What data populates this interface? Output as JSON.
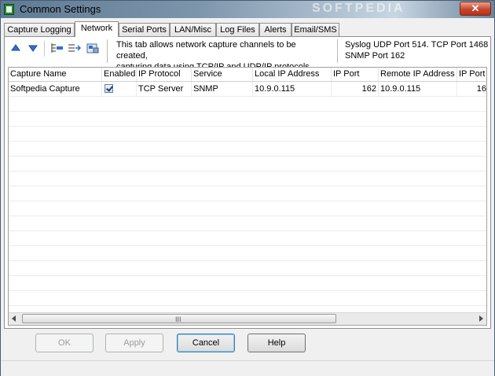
{
  "window": {
    "title": "Common Settings",
    "watermark": "SOFTPEDIA",
    "close_glyph": "✕"
  },
  "tabs": [
    {
      "label": "Capture Logging",
      "active": false
    },
    {
      "label": "Network",
      "active": true
    },
    {
      "label": "Serial Ports",
      "active": false
    },
    {
      "label": "LAN/Misc",
      "active": false
    },
    {
      "label": "Log Files",
      "active": false
    },
    {
      "label": "Alerts",
      "active": false
    },
    {
      "label": "Email/SMS",
      "active": false
    }
  ],
  "toolbar": {
    "icons": [
      "move-up-icon",
      "move-down-icon",
      "add-channel-icon",
      "insert-channel-icon",
      "channel-properties-icon"
    ]
  },
  "info": {
    "line1": "This tab allows network capture channels to be created,",
    "line2": "capturing data using TCP/IP and UDP/IP protocols",
    "ports_line1": "Syslog UDP Port 514. TCP Port 1468",
    "ports_line2": "SNMP Port 162"
  },
  "grid": {
    "columns": [
      "Capture Name",
      "Enabled",
      "IP Protocol",
      "Service",
      "Local IP Address",
      "IP Port",
      "Remote IP Address",
      "IP Port"
    ],
    "rows": [
      {
        "capture_name": "Softpedia Capture",
        "enabled": true,
        "ip_protocol": "TCP Server",
        "service": "SNMP",
        "local_ip": "10.9.0.115",
        "ip_port": "162",
        "remote_ip": "10.9.0.115",
        "remote_port": "16"
      }
    ],
    "scroll_grip": "III"
  },
  "buttons": {
    "ok": "OK",
    "apply": "Apply",
    "cancel": "Cancel",
    "help": "Help"
  },
  "colors": {
    "accent_blue": "#3a7bd5",
    "close_red": "#c9452b"
  }
}
